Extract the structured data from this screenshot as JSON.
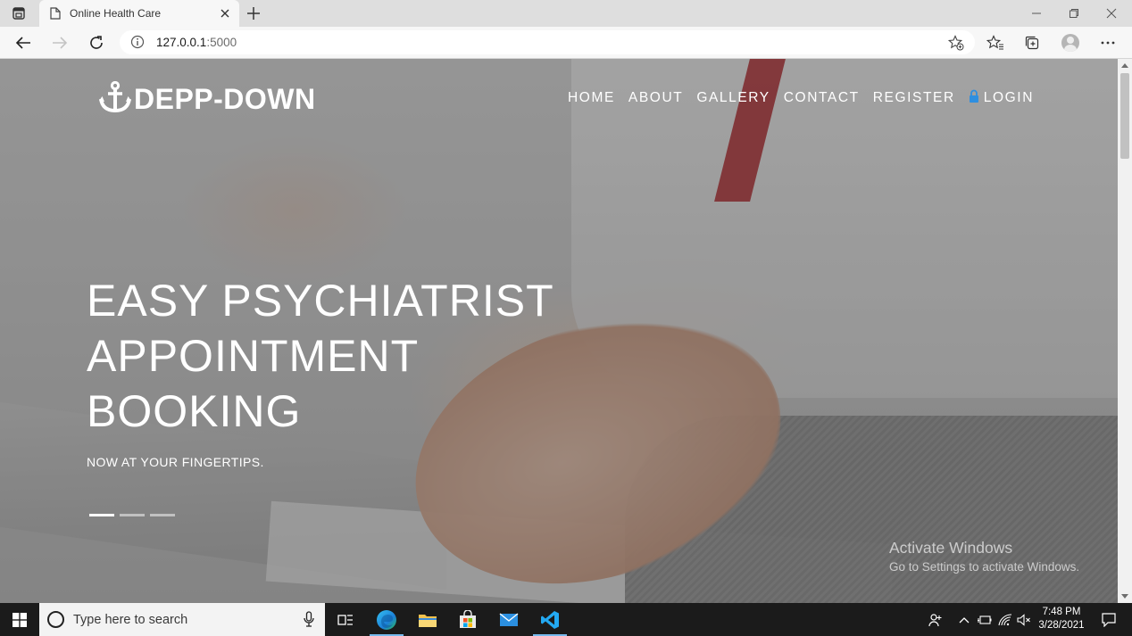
{
  "browser": {
    "tab_title": "Online Health Care",
    "url_host": "127.0.0.1",
    "url_port": ":5000"
  },
  "site": {
    "logo_text": "DEPP-DOWN",
    "nav": {
      "home": "HOME",
      "about": "ABOUT",
      "gallery": "GALLERY",
      "contact": "CONTACT",
      "register": "REGISTER",
      "login": "LOGIN"
    },
    "hero": {
      "headline_line1": "EASY PSYCHIATRIST",
      "headline_line2": "APPOINTMENT",
      "headline_line3": "BOOKING",
      "subline": "NOW AT YOUR FINGERTIPS.",
      "slides_total": 3,
      "active_slide": 1
    },
    "colors": {
      "lock_icon": "#2f8fe0",
      "overlay": "#282828"
    }
  },
  "watermark": {
    "line1": "Activate Windows",
    "line2": "Go to Settings to activate Windows."
  },
  "taskbar": {
    "search_placeholder": "Type here to search",
    "time": "7:48 PM",
    "date": "3/28/2021",
    "apps": [
      "task-view",
      "edge",
      "file-explorer",
      "microsoft-store",
      "mail",
      "vs-code"
    ]
  }
}
